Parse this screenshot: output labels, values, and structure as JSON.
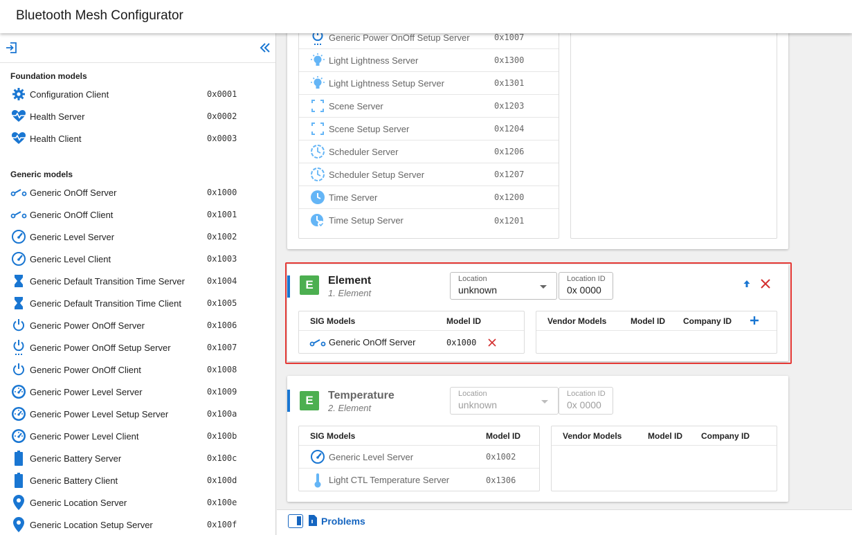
{
  "app": {
    "title": "Bluetooth Mesh Configurator"
  },
  "colors": {
    "accent": "#1976d2",
    "element_badge": "#4caf50",
    "danger": "#d32f2f",
    "highlight": "#e53935"
  },
  "sidebar": {
    "foundation_title": "Foundation models",
    "foundation": [
      {
        "label": "Configuration Client",
        "id": "0x0001",
        "icon": "gear-icon"
      },
      {
        "label": "Health Server",
        "id": "0x0002",
        "icon": "heartbeat-icon"
      },
      {
        "label": "Health Client",
        "id": "0x0003",
        "icon": "heartbeat-icon"
      }
    ],
    "generic_title": "Generic models",
    "generic": [
      {
        "label": "Generic OnOff Server",
        "id": "0x1000",
        "icon": "switch-icon"
      },
      {
        "label": "Generic OnOff Client",
        "id": "0x1001",
        "icon": "switch-icon"
      },
      {
        "label": "Generic Level Server",
        "id": "0x1002",
        "icon": "gauge-icon"
      },
      {
        "label": "Generic Level Client",
        "id": "0x1003",
        "icon": "gauge-icon"
      },
      {
        "label": "Generic Default Transition Time Server",
        "id": "0x1004",
        "icon": "hourglass-icon"
      },
      {
        "label": "Generic Default Transition Time Client",
        "id": "0x1005",
        "icon": "hourglass-icon"
      },
      {
        "label": "Generic Power OnOff Server",
        "id": "0x1006",
        "icon": "power-icon"
      },
      {
        "label": "Generic Power OnOff Setup Server",
        "id": "0x1007",
        "icon": "power-setup-icon"
      },
      {
        "label": "Generic Power OnOff Client",
        "id": "0x1008",
        "icon": "power-icon"
      },
      {
        "label": "Generic Power Level Server",
        "id": "0x1009",
        "icon": "speedometer-icon"
      },
      {
        "label": "Generic Power Level Setup Server",
        "id": "0x100a",
        "icon": "speedometer-icon"
      },
      {
        "label": "Generic Power Level Client",
        "id": "0x100b",
        "icon": "speedometer-icon"
      },
      {
        "label": "Generic Battery Server",
        "id": "0x100c",
        "icon": "battery-icon"
      },
      {
        "label": "Generic Battery Client",
        "id": "0x100d",
        "icon": "battery-icon"
      },
      {
        "label": "Generic Location Server",
        "id": "0x100e",
        "icon": "location-pin-icon"
      },
      {
        "label": "Generic Location Setup Server",
        "id": "0x100f",
        "icon": "location-pin-icon"
      }
    ]
  },
  "top_card": {
    "models": [
      {
        "label": "Generic Power OnOff Setup Server",
        "id": "0x1007",
        "icon": "power-setup-icon"
      },
      {
        "label": "Light Lightness Server",
        "id": "0x1300",
        "icon": "lightbulb-icon"
      },
      {
        "label": "Light Lightness Setup Server",
        "id": "0x1301",
        "icon": "lightbulb-icon"
      },
      {
        "label": "Scene Server",
        "id": "0x1203",
        "icon": "scene-frame-icon"
      },
      {
        "label": "Scene Setup Server",
        "id": "0x1204",
        "icon": "scene-frame-icon"
      },
      {
        "label": "Scheduler Server",
        "id": "0x1206",
        "icon": "clock-dashed-icon"
      },
      {
        "label": "Scheduler Setup Server",
        "id": "0x1207",
        "icon": "clock-dashed-icon"
      },
      {
        "label": "Time Server",
        "id": "0x1200",
        "icon": "clock-icon"
      },
      {
        "label": "Time Setup Server",
        "id": "0x1201",
        "icon": "clock-check-icon"
      }
    ]
  },
  "element1": {
    "badge": "E",
    "name": "Element",
    "subtitle": "1. Element",
    "location_label": "Location",
    "location_value": "unknown",
    "location_id_label": "Location ID",
    "location_id_value": "0x 0000",
    "sig_header": "SIG Models",
    "model_id_header": "Model ID",
    "vendor_header": "Vendor Models",
    "vendor_model_id_header": "Model ID",
    "company_id_header": "Company ID",
    "sig_models": [
      {
        "label": "Generic OnOff Server",
        "id": "0x1000",
        "icon": "switch-icon"
      }
    ]
  },
  "element2": {
    "badge": "E",
    "name": "Temperature",
    "subtitle": "2. Element",
    "location_label": "Location",
    "location_value": "unknown",
    "location_id_label": "Location ID",
    "location_id_value": "0x 0000",
    "sig_header": "SIG Models",
    "model_id_header": "Model ID",
    "vendor_header": "Vendor Models",
    "vendor_model_id_header": "Model ID",
    "company_id_header": "Company ID",
    "sig_models": [
      {
        "label": "Generic Level Server",
        "id": "0x1002",
        "icon": "gauge-icon"
      },
      {
        "label": "Light CTL Temperature Server",
        "id": "0x1306",
        "icon": "thermometer-icon"
      }
    ]
  },
  "problems": {
    "label": "Problems"
  }
}
